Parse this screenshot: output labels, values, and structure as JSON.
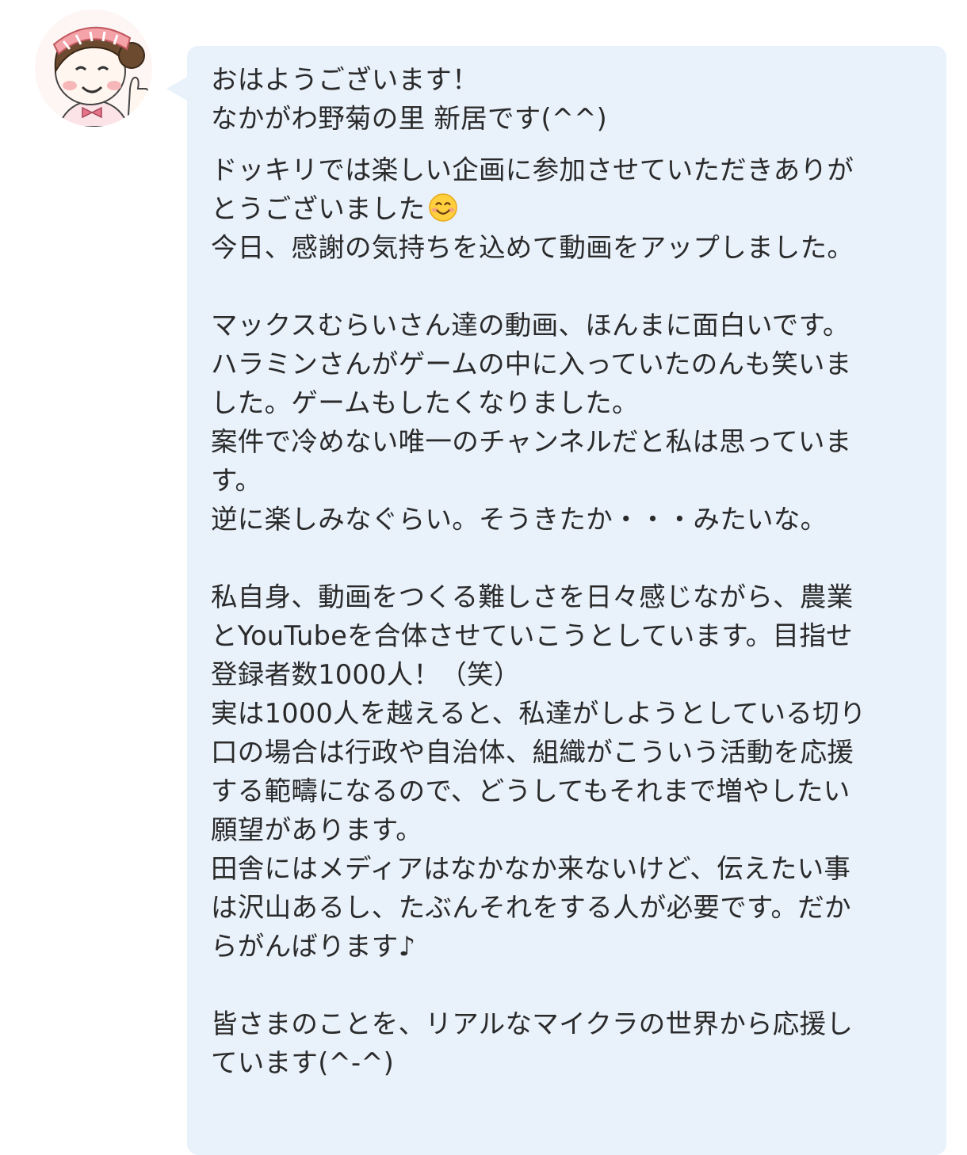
{
  "sender": {
    "avatar_icon": "woman-avatar-thumbs-up-icon"
  },
  "message": {
    "greeting": [
      "おはようございます！",
      "なかがわ野菊の里 新居です(^^)"
    ],
    "paragraph1": {
      "line1": "ドッキリでは楽しい企画に参加させていただきありが",
      "line2": "とうございました",
      "line2_emoji_icon": "smiling-face-emoji-icon",
      "line3": "今日、感謝の気持ちを込めて動画をアップしました。"
    },
    "paragraph2": [
      "マックスむらいさん達の動画、ほんまに面白いです。",
      "ハラミンさんがゲームの中に入っていたのんも笑いま",
      "した。ゲームもしたくなりました。",
      "案件で冷めない唯一のチャンネルだと私は思っていま",
      "す。",
      "逆に楽しみなぐらい。そうきたか・・・みたいな。"
    ],
    "paragraph3": [
      "私自身、動画をつくる難しさを日々感じながら、農業",
      "とYouTubeを合体させていこうとしています。目指せ",
      "登録者数1000人！（笑）",
      "実は1000人を越えると、私達がしようとしている切り",
      "口の場合は行政や自治体、組織がこういう活動を応援",
      "する範疇になるので、どうしてもそれまで増やしたい",
      "願望があります。",
      "田舎にはメディアはなかなか来ないけど、伝えたい事",
      "は沢山あるし、たぶんそれをする人が必要です。だか",
      "らがんばります♪"
    ],
    "paragraph4": [
      "皆さまのことを、リアルなマイクラの世界から応援し",
      "ています(^-^)"
    ]
  },
  "colors": {
    "bubble_background": "#e9f1fb",
    "text": "#2a2a2a"
  }
}
